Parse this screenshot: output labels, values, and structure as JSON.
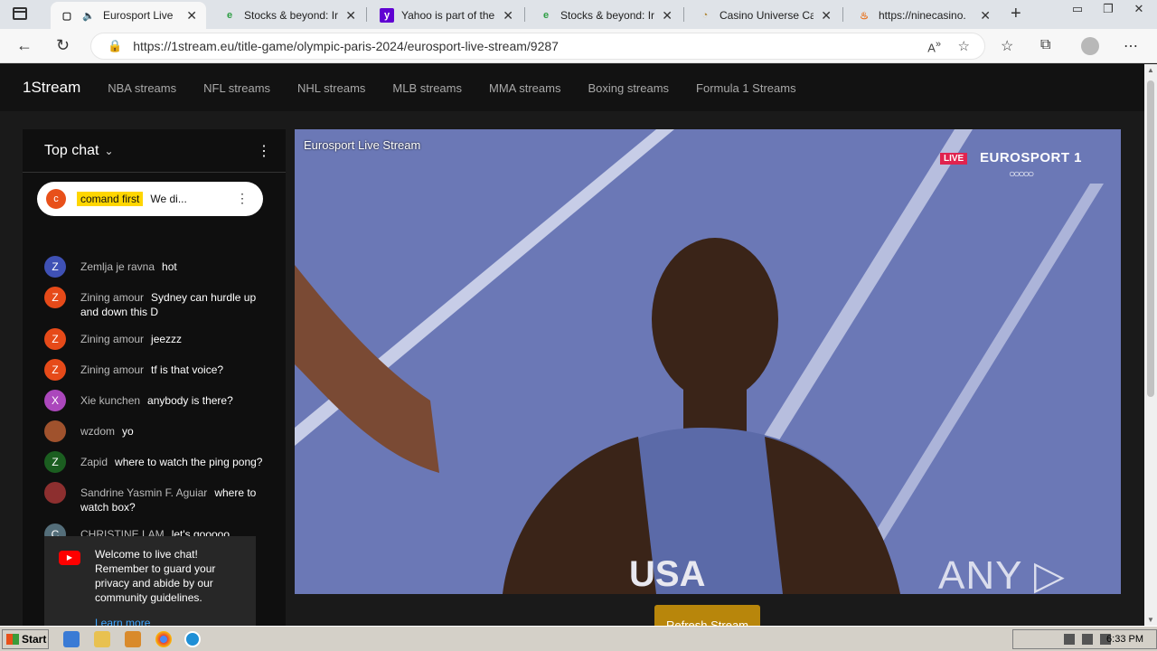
{
  "browser": {
    "tabs": [
      {
        "title": "Eurosport Live",
        "favicon": "page-icon",
        "audio": true,
        "active": true
      },
      {
        "title": "Stocks & beyond: Ir",
        "favicon": "stocks-icon"
      },
      {
        "title": "Yahoo is part of the",
        "favicon": "yahoo-icon"
      },
      {
        "title": "Stocks & beyond: Ir",
        "favicon": "stocks-icon"
      },
      {
        "title": "Casino Universe Ca",
        "favicon": "casino-icon"
      },
      {
        "title": "https://ninecasino.",
        "favicon": "nine-icon"
      }
    ],
    "url": "https://1stream.eu/title-game/olympic-paris-2024/eurosport-live-stream/9287"
  },
  "site": {
    "brand": "1Stream",
    "nav": [
      "NBA streams",
      "NFL streams",
      "NHL streams",
      "MLB streams",
      "MMA streams",
      "Boxing streams",
      "Formula 1 Streams"
    ]
  },
  "chat": {
    "header": "Top chat",
    "pinned": {
      "avatar": "c",
      "author": "comand first",
      "text": "We di..."
    },
    "messages": [
      {
        "avatar": "Z",
        "color": "#3f51b5",
        "author": "Zemlja je ravna",
        "text": "hot"
      },
      {
        "avatar": "Z",
        "color": "#e64a19",
        "author": "Zining amour",
        "text": "Sydney can hurdle up and down this D"
      },
      {
        "avatar": "Z",
        "color": "#e64a19",
        "author": "Zining amour",
        "text": "jeezzz"
      },
      {
        "avatar": "Z",
        "color": "#e64a19",
        "author": "Zining amour",
        "text": "tf is that voice?"
      },
      {
        "avatar": "X",
        "color": "#ab47bc",
        "author": "Xie kunchen",
        "text": "anybody is there?"
      },
      {
        "avatar": "",
        "color": "#a0522d",
        "author": "wzdom",
        "text": "yo"
      },
      {
        "avatar": "Z",
        "color": "#1b5e20",
        "author": "Zapid",
        "text": "where to watch the ping pong?"
      },
      {
        "avatar": "",
        "color": "#8d2f2f",
        "author": "Sandrine Yasmin F. Aguiar",
        "text": "where to watch box?"
      },
      {
        "avatar": "C",
        "color": "#546e7a",
        "author": "CHRISTINE LAM",
        "text": "let's gooooo"
      }
    ],
    "welcome": {
      "text": "Welcome to live chat! Remember to guard your privacy and abide by our community guidelines.",
      "link": "Learn more"
    }
  },
  "player": {
    "title": "Eurosport Live Stream",
    "live_badge": "LIVE",
    "channel": "EUROSPORT 1",
    "rings": "○○○○○",
    "watermark": "ANY ▷ RUN"
  },
  "refresh_label": "Refresh Stream",
  "taskbar": {
    "start": "Start",
    "time": "6:33 PM"
  }
}
